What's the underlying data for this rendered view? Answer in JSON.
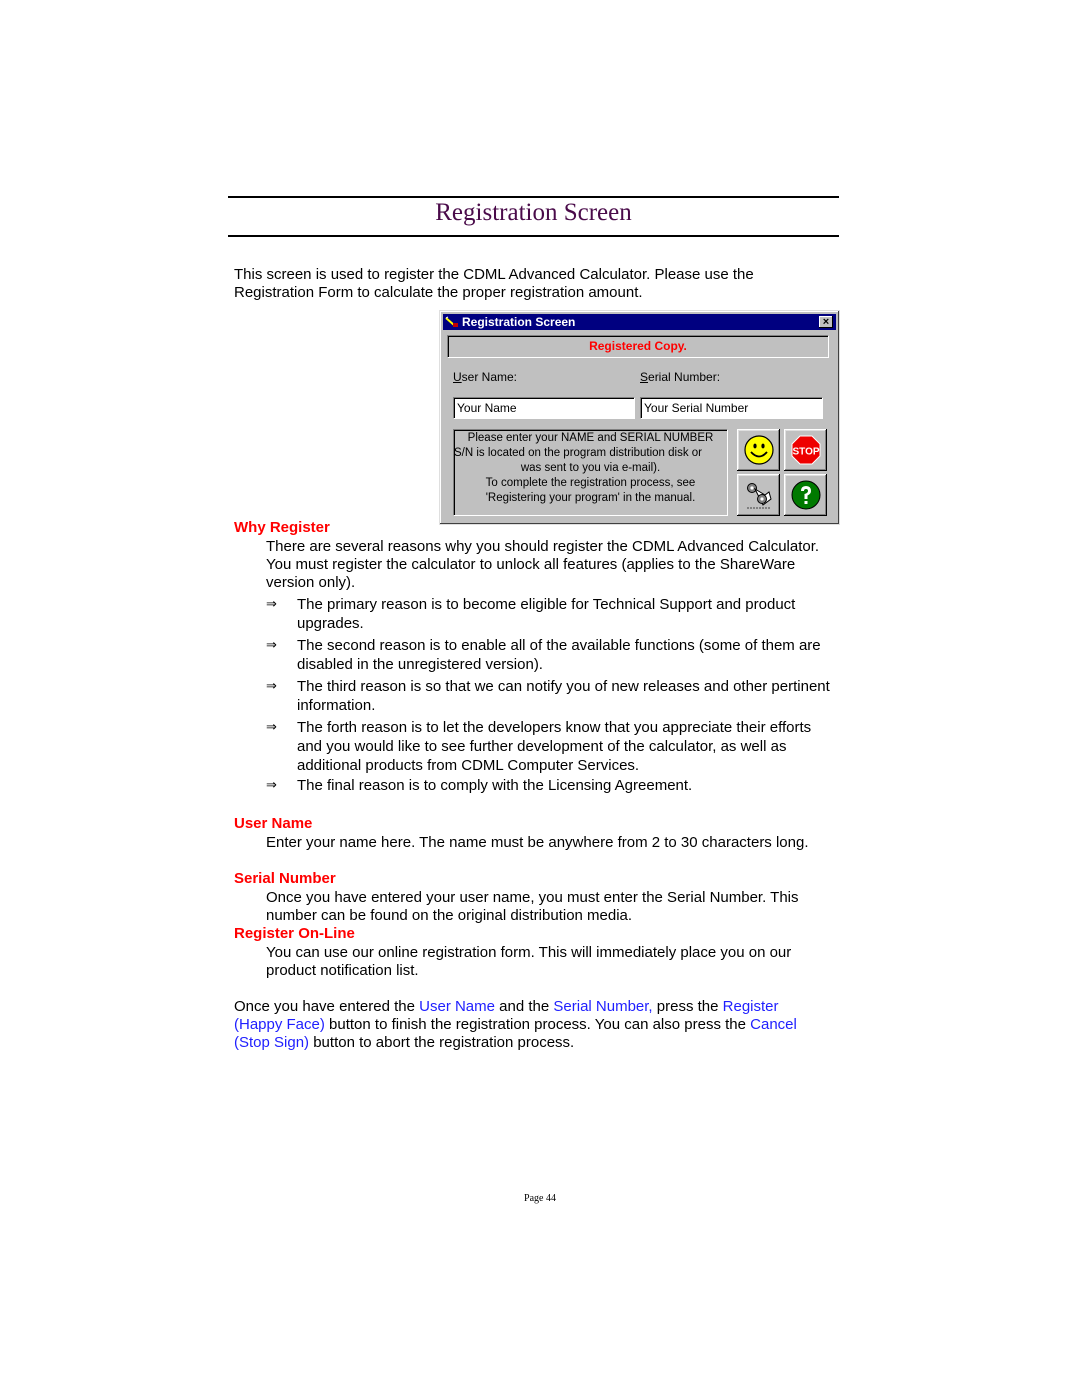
{
  "page": {
    "title": "Registration Screen",
    "intro": "This screen is used to register the CDML Advanced Calculator. Please use the Registration Form to calculate the proper registration amount.",
    "footer": "Page 44"
  },
  "dialog": {
    "title": "Registration Screen",
    "close_label": "×",
    "status": "Registered Copy.",
    "user_name_label_accel": "U",
    "user_name_label_rest": "ser Name:",
    "serial_label_accel": "S",
    "serial_label_rest": "erial Number:",
    "user_name_value": "Your Name",
    "serial_value": "Your Serial Number",
    "message_lines": [
      "Please enter your NAME and SERIAL NUMBER",
      "S/N is located on the program distribution disk or",
      "was sent to you via e-mail).",
      "To complete the registration process, see",
      "'Registering your program' in the manual."
    ],
    "buttons": {
      "register": "happy-face",
      "cancel": "stop-sign",
      "online": "handshake",
      "help": "question-mark"
    },
    "stop_text": "STOP"
  },
  "sections": {
    "why": {
      "heading": "Why Register",
      "body": "There are several reasons why you should register the CDML Advanced Calculator.   You must register the calculator to unlock all features (applies to the ShareWare version only).",
      "bullet_glyph": "⇒",
      "bullets": [
        "The primary reason is to become eligible for Technical Support and product upgrades.",
        "The second reason is to enable all of the available functions (some of them are disabled in the unregistered version).",
        "The third reason is so that we can notify you of new releases and other pertinent information.",
        "The forth reason is to let the developers know that you appreciate their efforts and you would like to see further development of the calculator, as well as additional products from CDML Computer Services.",
        "The final reason is to comply with the Licensing Agreement."
      ]
    },
    "user_name": {
      "heading": "User Name",
      "body": "Enter your name here.  The name must be anywhere from 2 to 30 characters long."
    },
    "serial": {
      "heading": "Serial Number",
      "body": "Once you have entered your user name, you must enter the Serial Number. This number can be found on the original distribution media."
    },
    "online": {
      "heading": "Register On-Line",
      "body": "You can use our online registration form. This will immediately place you on our product notification list."
    }
  },
  "closing": {
    "t1": "Once you have entered the ",
    "l1": "User Name",
    "t2": " and the ",
    "l2": "Serial Number,",
    "t3": " press the ",
    "l3": "Register (Happy Face)",
    "t4": " button to finish the registration process. You can also press the ",
    "l4": "Cancel (Stop Sign)",
    "t5": " button to abort the registration process."
  },
  "colors": {
    "heading_red": "#ff0000",
    "title_purple": "#4a0b4a",
    "link_blue": "#1f1fff",
    "dialog_titlebar": "#000080"
  }
}
